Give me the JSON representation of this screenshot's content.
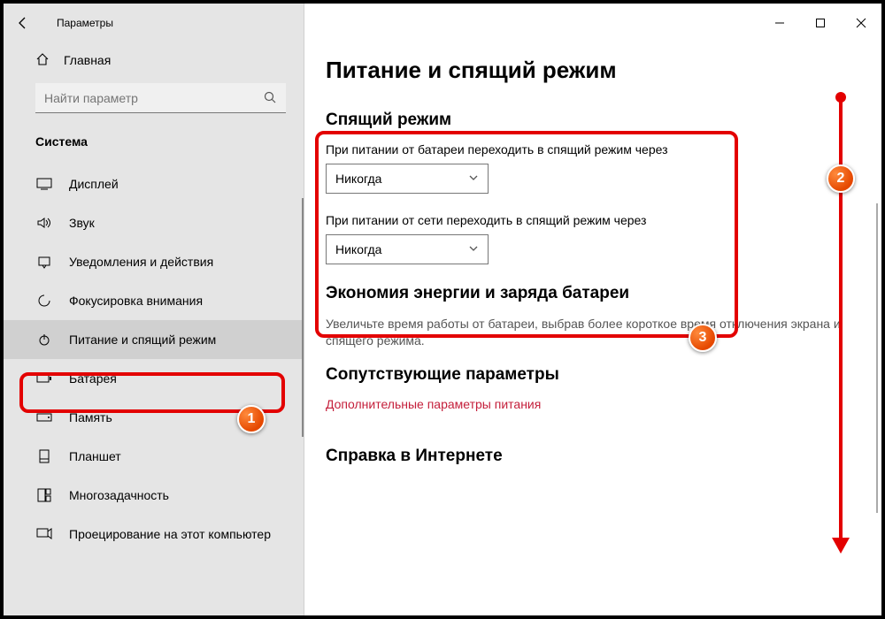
{
  "app_title": "Параметры",
  "home_label": "Главная",
  "search_placeholder": "Найти параметр",
  "section_label": "Система",
  "nav": [
    {
      "label": "Дисплей"
    },
    {
      "label": "Звук"
    },
    {
      "label": "Уведомления и действия"
    },
    {
      "label": "Фокусировка внимания"
    },
    {
      "label": "Питание и спящий режим"
    },
    {
      "label": "Батарея"
    },
    {
      "label": "Память"
    },
    {
      "label": "Планшет"
    },
    {
      "label": "Многозадачность"
    },
    {
      "label": "Проецирование на этот компьютер"
    }
  ],
  "page": {
    "title": "Питание и спящий режим",
    "sleep_heading": "Спящий режим",
    "battery_label": "При питании от батареи переходить в спящий режим через",
    "battery_value": "Никогда",
    "plugged_label": "При питании от сети переходить в спящий режим через",
    "plugged_value": "Никогда",
    "energy_heading": "Экономия энергии и заряда батареи",
    "energy_help": "Увеличьте время работы от батареи, выбрав более короткое время отключения экрана и спящего режима.",
    "related_heading": "Сопутствующие параметры",
    "related_link": "Дополнительные параметры питания",
    "web_help_heading": "Справка в Интернете"
  },
  "steps": {
    "s1": "1",
    "s2": "2",
    "s3": "3"
  }
}
